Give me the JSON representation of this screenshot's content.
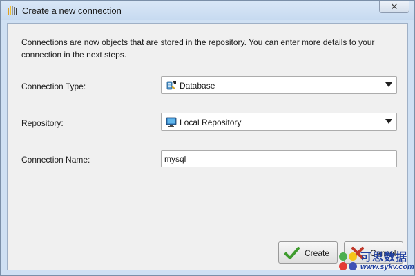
{
  "window": {
    "title": "Create a new connection",
    "close_glyph": "✕"
  },
  "intro_text": "Connections are now objects that are stored in the repository. You can enter more details to your connection in the next steps.",
  "form": {
    "connection_type": {
      "label": "Connection Type:",
      "value": "Database",
      "icon": "database-icon"
    },
    "repository": {
      "label": "Repository:",
      "value": "Local Repository",
      "icon": "monitor-icon"
    },
    "connection_name": {
      "label": "Connection Name:",
      "value": "mysql"
    }
  },
  "buttons": {
    "create": {
      "label": "Create",
      "icon": "checkmark-icon",
      "icon_color": "#3e9b2d"
    },
    "cancel": {
      "label": "Cancel",
      "icon": "cross-icon",
      "icon_color": "#c0392b"
    }
  },
  "watermark": {
    "text": "可思数据",
    "url": "www.sykv.com"
  },
  "colors": {
    "window_frame": "#cfe0f3",
    "dialog_body": "#f0f0f0",
    "watermark_blue": "#1f3fa0"
  }
}
